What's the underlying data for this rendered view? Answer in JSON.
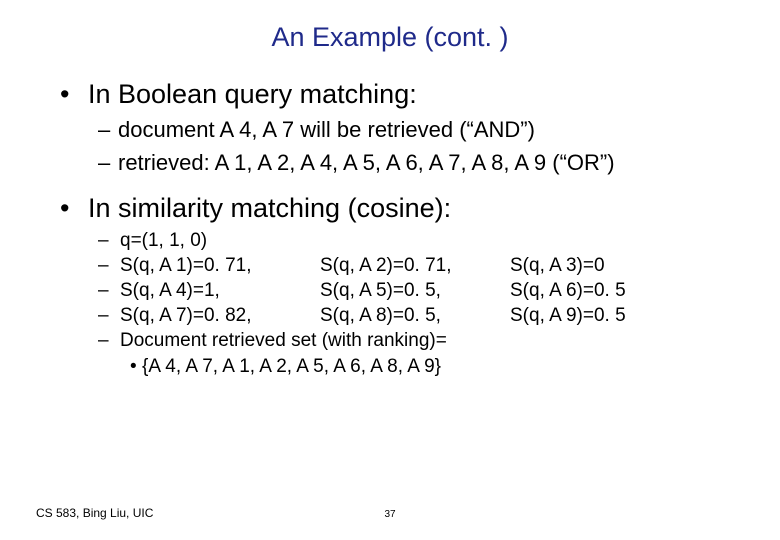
{
  "title": "An Example (cont. )",
  "section1": {
    "heading": "In Boolean query matching:",
    "items": [
      "document A 4, A 7 will be retrieved (“AND”)",
      "retrieved: A 1, A 2, A 4, A 5, A 6, A 7, A 8, A 9 (“OR”)"
    ]
  },
  "section2": {
    "heading": "In similarity matching (cosine):",
    "rows": [
      {
        "c1": "q=(1, 1, 0)",
        "c2": "",
        "c3": ""
      },
      {
        "c1": "S(q, A 1)=0. 71,",
        "c2": "S(q, A 2)=0. 71,",
        "c3": "S(q, A 3)=0"
      },
      {
        "c1": "S(q, A 4)=1,",
        "c2": "S(q, A 5)=0. 5,",
        "c3": "S(q, A 6)=0. 5"
      },
      {
        "c1": "S(q, A 7)=0. 82,",
        "c2": "S(q, A 8)=0. 5,",
        "c3": "S(q, A 9)=0. 5"
      },
      {
        "c1": "Document retrieved set (with ranking)=",
        "c2": "",
        "c3": ""
      }
    ],
    "retrieved_set": "{A 4, A 7, A 1, A 2, A 5, A 6, A 8, A 9}"
  },
  "footer": "CS 583, Bing Liu, UIC",
  "page_number": "37"
}
